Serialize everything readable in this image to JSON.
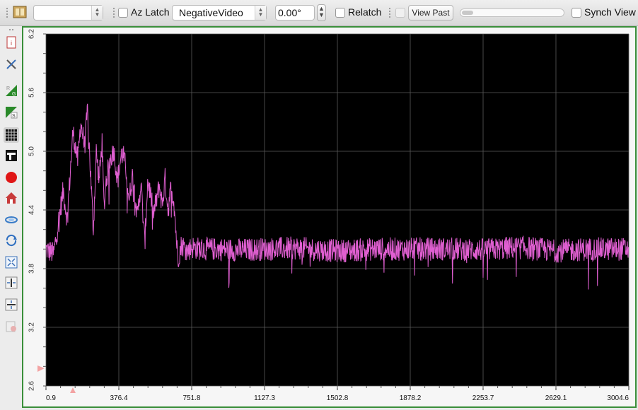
{
  "toolbar": {
    "combo_value": "",
    "az_latch_label": "Az Latch",
    "mode_value": "NegativeVideo",
    "angle_value": "0.00°",
    "relatch_label": "Relatch",
    "view_past_label": "View Past",
    "synch_view_label": "Synch View"
  },
  "sidebar": {
    "icons": [
      "info-icon",
      "tools-icon",
      "rg-channel-icon",
      "s-channel-icon",
      "grid-icon",
      "filter-icon",
      "record-icon",
      "home-icon",
      "link-icon",
      "refresh-icon",
      "expand-icon",
      "fit-horizontal-icon",
      "fit-vertical-icon",
      "disabled-tool-icon"
    ]
  },
  "colors": {
    "trace": "#e05fd1",
    "plot_background": "#000000",
    "frame_border": "#3a8f3a",
    "marker": "#f3a3a3"
  },
  "chart_data": {
    "type": "line",
    "title": "",
    "xlabel": "",
    "ylabel": "",
    "x_ticks": [
      "0.9",
      "376.4",
      "751.8",
      "1127.3",
      "1502.8",
      "1878.2",
      "2253.7",
      "2629.1",
      "3004.6"
    ],
    "y_ticks": [
      "2.6",
      "3.2",
      "3.8",
      "4.4",
      "5.0",
      "5.6",
      "6.2"
    ],
    "xlim": [
      0.9,
      3004.6
    ],
    "ylim": [
      2.6,
      6.2
    ],
    "grid": true,
    "series": [
      {
        "values_x": [
          0.9,
          40,
          90,
          110,
          140,
          165,
          180,
          200,
          215,
          230,
          245,
          260,
          275,
          290,
          300,
          310,
          330,
          350,
          370,
          390,
          400,
          415,
          430,
          445,
          460,
          470,
          490,
          510,
          525,
          540,
          555,
          570,
          585,
          600,
          615,
          630,
          645,
          660,
          680,
          700,
          730,
          751.8,
          800,
          900,
          1000,
          1127.3,
          1300,
          1502.8,
          1700,
          1878.2,
          2100,
          2253.7,
          2450,
          2629.1,
          2800,
          3004.6
        ],
        "values_y": [
          4.0,
          3.95,
          4.6,
          4.3,
          5.2,
          4.9,
          5.3,
          5.05,
          5.42,
          4.8,
          4.2,
          5.0,
          4.7,
          5.1,
          4.4,
          4.7,
          4.9,
          5.02,
          4.7,
          4.97,
          4.95,
          4.8,
          4.5,
          4.75,
          4.62,
          4.3,
          4.68,
          4.05,
          4.7,
          4.56,
          4.35,
          4.5,
          4.65,
          4.45,
          4.72,
          4.4,
          4.62,
          4.5,
          3.9,
          4.05,
          3.98,
          4.02,
          4.0,
          4.0,
          3.99,
          4.0,
          4.01,
          3.98,
          4.0,
          4.0,
          4.0,
          3.99,
          4.02,
          3.98,
          4.0,
          4.0
        ],
        "noise_amplitude": 0.12
      }
    ]
  }
}
